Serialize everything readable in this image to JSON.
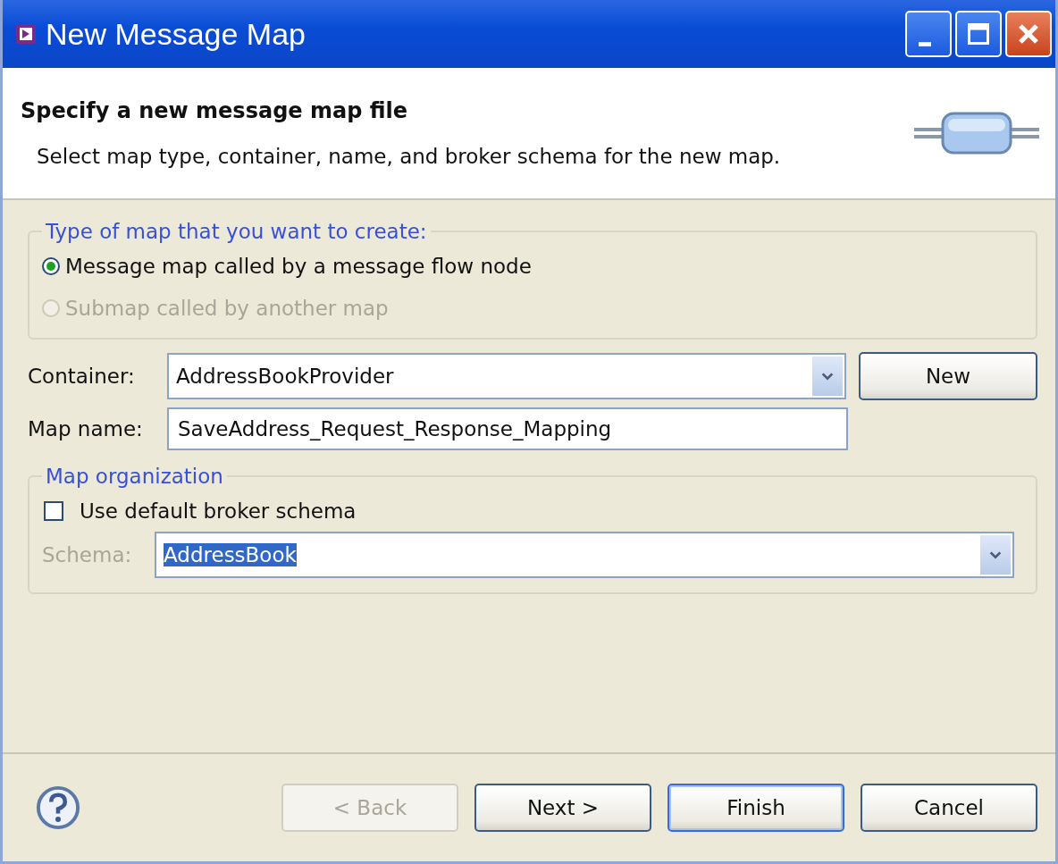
{
  "window": {
    "title": "New Message Map"
  },
  "header": {
    "title": "Specify a new message map file",
    "description": "Select map type, container, name, and broker schema for the new map."
  },
  "map_type": {
    "legend": "Type of map that you want to create:",
    "options": [
      {
        "label": "Message map called by a message flow node",
        "selected": true,
        "disabled": false
      },
      {
        "label": "Submap called by another map",
        "selected": false,
        "disabled": true
      }
    ]
  },
  "container": {
    "label": "Container:",
    "value": "AddressBookProvider",
    "button": "New"
  },
  "map_name": {
    "label": "Map name:",
    "value": "SaveAddress_Request_Response_Mapping"
  },
  "organization": {
    "legend": "Map organization",
    "checkbox": {
      "label": "Use default broker schema",
      "checked": false
    },
    "schema": {
      "label": "Schema:",
      "value": "AddressBook",
      "disabled": false,
      "highlighted": true
    }
  },
  "buttons": [
    {
      "label": "< Back",
      "disabled": true,
      "default": false
    },
    {
      "label": "Next >",
      "disabled": false,
      "default": false
    },
    {
      "label": "Finish",
      "disabled": false,
      "default": true
    },
    {
      "label": "Cancel",
      "disabled": false,
      "default": false
    }
  ]
}
